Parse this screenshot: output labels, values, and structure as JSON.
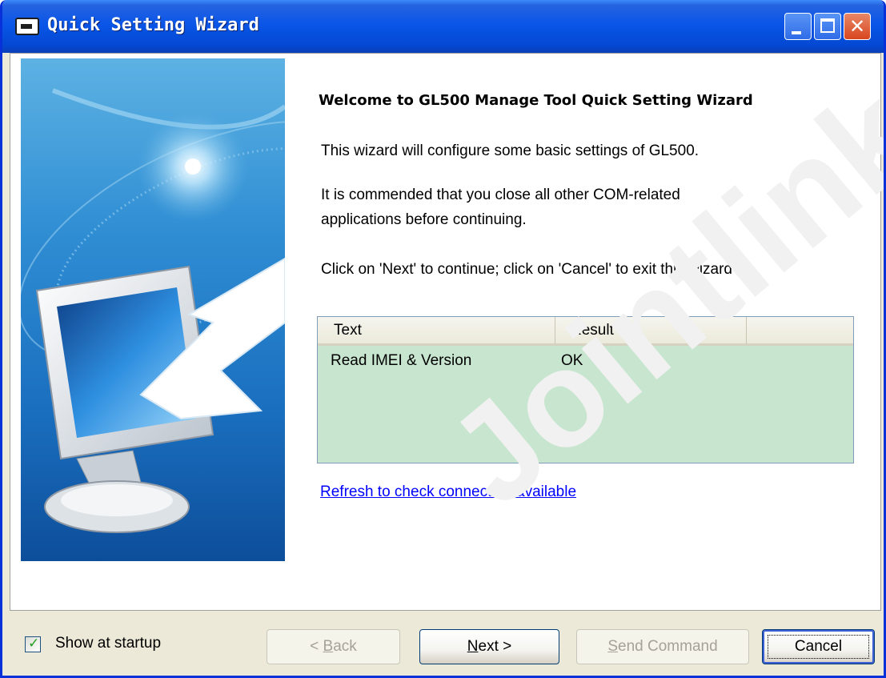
{
  "window": {
    "title": "Quick Setting Wizard"
  },
  "wizard": {
    "heading": "Welcome to GL500 Manage Tool  Quick Setting Wizard",
    "paragraph1": "This wizard will configure some basic settings of GL500.",
    "paragraph2_line1": "It is commended that you close all other COM-related",
    "paragraph2_line2": "applications before continuing.",
    "paragraph3": "Click on 'Next' to continue; click on 'Cancel' to exit this wizard"
  },
  "results": {
    "columns": [
      "Text",
      "Result"
    ],
    "rows": [
      {
        "text": "Read IMEI & Version",
        "result": "OK"
      }
    ]
  },
  "refresh_link": "Refresh to check connection available",
  "show_at_startup": {
    "label": "Show at startup",
    "checked": true
  },
  "buttons": {
    "back_prefix": "< ",
    "back_accel": "B",
    "back_rest": "ack",
    "next_accel": "N",
    "next_rest": "ext >",
    "send_accel": "S",
    "send_rest": "end Command",
    "cancel": "Cancel"
  },
  "watermark": "Jointlink",
  "colors": {
    "title_bar": "#0A56E8",
    "dialog_face": "#ECE9D8",
    "list_background": "#C8E6CF",
    "link": "#0000FF"
  }
}
